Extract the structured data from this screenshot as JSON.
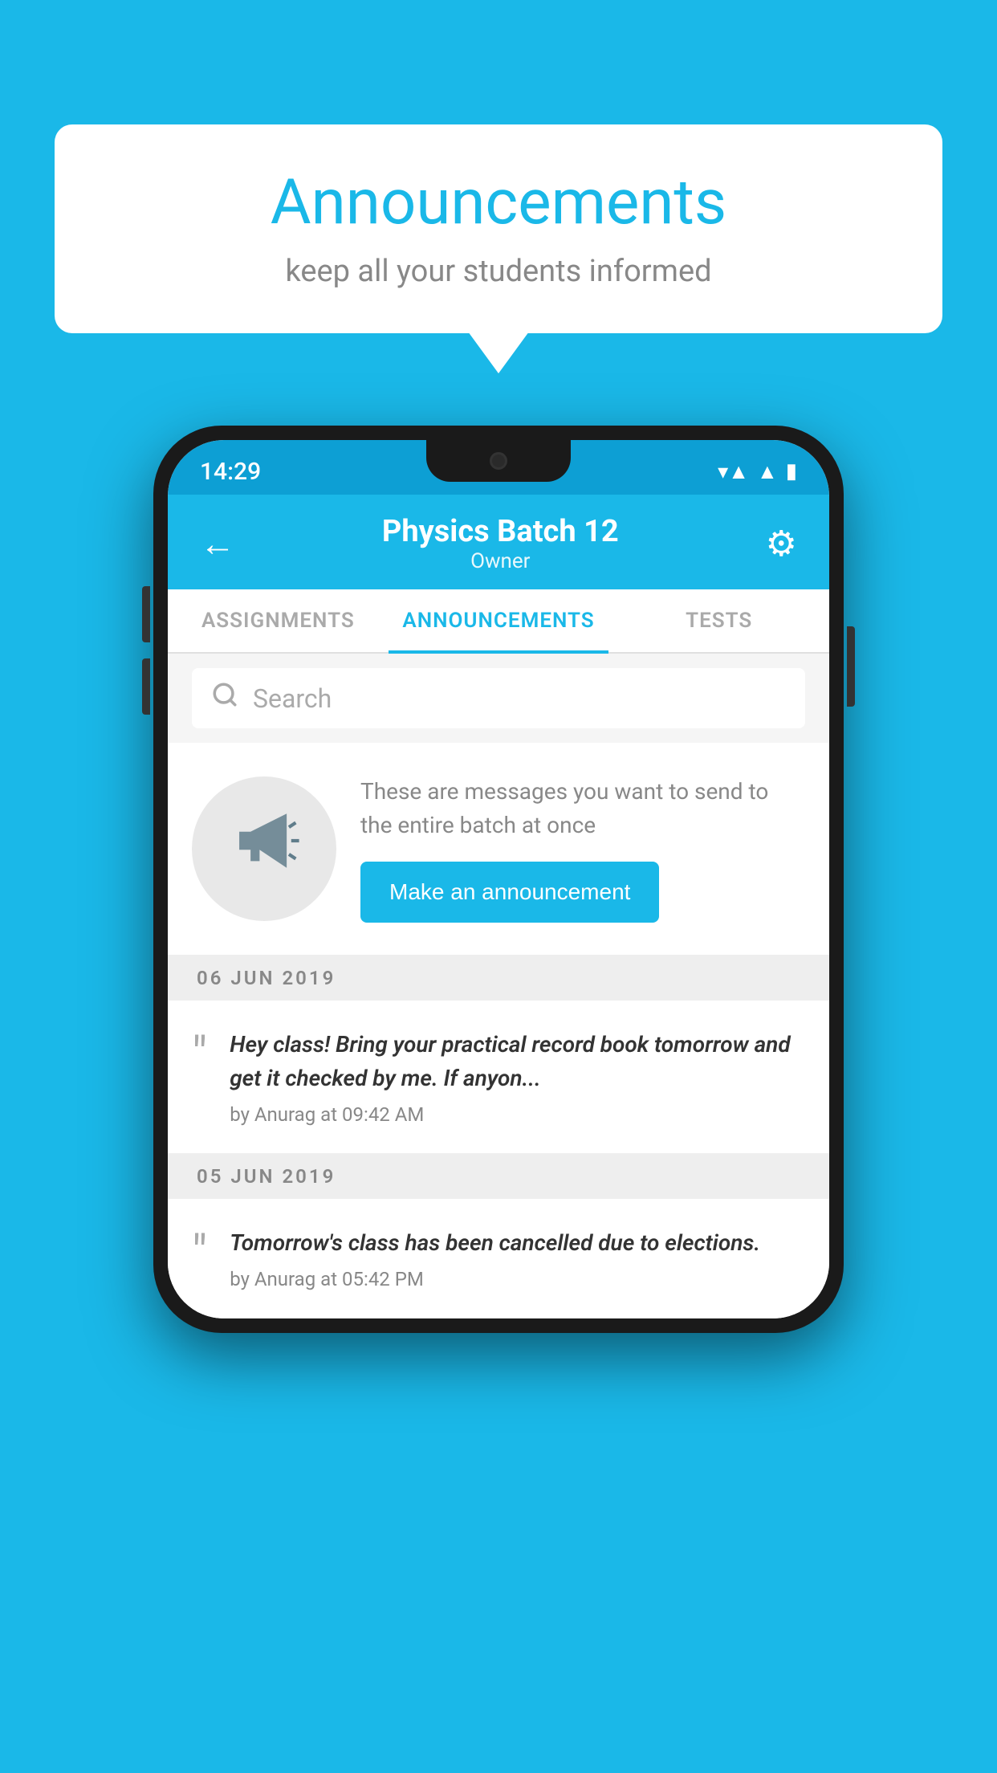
{
  "background_color": "#1ab8e8",
  "speech_bubble": {
    "title": "Announcements",
    "subtitle": "keep all your students informed"
  },
  "phone": {
    "status_bar": {
      "time": "14:29",
      "icons": [
        "wifi",
        "signal",
        "battery"
      ]
    },
    "header": {
      "back_label": "←",
      "title": "Physics Batch 12",
      "subtitle": "Owner",
      "gear_label": "⚙"
    },
    "tabs": [
      {
        "label": "ASSIGNMENTS",
        "active": false
      },
      {
        "label": "ANNOUNCEMENTS",
        "active": true
      },
      {
        "label": "TESTS",
        "active": false
      }
    ],
    "search": {
      "placeholder": "Search"
    },
    "promo": {
      "description": "These are messages you want to send to the entire batch at once",
      "button_label": "Make an announcement"
    },
    "announcements": [
      {
        "date": "06  JUN  2019",
        "text": "Hey class! Bring your practical record book tomorrow and get it checked by me. If anyon...",
        "meta": "by Anurag at 09:42 AM"
      },
      {
        "date": "05  JUN  2019",
        "text": "Tomorrow's class has been cancelled due to elections.",
        "meta": "by Anurag at 05:42 PM"
      }
    ]
  }
}
